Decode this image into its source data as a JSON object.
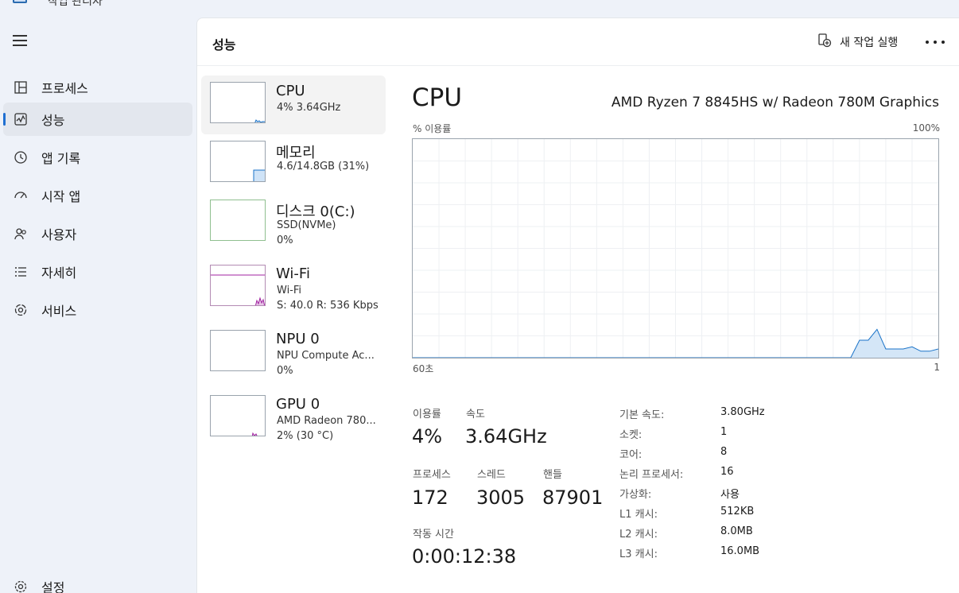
{
  "window": {
    "title": "작업 관리자"
  },
  "sidebar": {
    "items": [
      {
        "label": "프로세스",
        "icon": "processes-icon"
      },
      {
        "label": "성능",
        "icon": "performance-icon",
        "active": true
      },
      {
        "label": "앱 기록",
        "icon": "history-icon"
      },
      {
        "label": "시작 앱",
        "icon": "startup-icon"
      },
      {
        "label": "사용자",
        "icon": "users-icon"
      },
      {
        "label": "자세히",
        "icon": "details-icon"
      },
      {
        "label": "서비스",
        "icon": "services-icon"
      }
    ],
    "settings_label": "설정"
  },
  "header": {
    "title": "성능",
    "run_task_label": "새 작업 실행"
  },
  "devices": [
    {
      "name": "CPU",
      "sub1": "4% 3.64GHz",
      "sub2": "",
      "color": "#1a73c8"
    },
    {
      "name": "메모리",
      "sub1": "4.6/14.8GB (31%)",
      "sub2": "",
      "color": "#1a73c8"
    },
    {
      "name": "디스크 0(C:)",
      "sub1": "SSD(NVMe)",
      "sub2": "0%",
      "color": "#4caf50"
    },
    {
      "name": "Wi-Fi",
      "sub1": "Wi-Fi",
      "sub2": "S: 40.0 R: 536 Kbps",
      "color": "#a020a0"
    },
    {
      "name": "NPU 0",
      "sub1": "NPU Compute Ac...",
      "sub2": "0%",
      "color": "#1a73c8"
    },
    {
      "name": "GPU 0",
      "sub1": "AMD Radeon 780...",
      "sub2": "2% (30 °C)",
      "color": "#a020a0"
    }
  ],
  "detail": {
    "title": "CPU",
    "model": "AMD Ryzen 7 8845HS w/ Radeon 780M Graphics",
    "graph_label_left": "% 이용률",
    "graph_label_right": "100%",
    "graph_bottom_left": "60초",
    "graph_bottom_right": "1",
    "stats": {
      "utilization_label": "이용률",
      "utilization": "4%",
      "speed_label": "속도",
      "speed": "3.64GHz",
      "processes_label": "프로세스",
      "processes": "172",
      "threads_label": "스레드",
      "threads": "3005",
      "handles_label": "핸들",
      "handles": "87901",
      "uptime_label": "작동 시간",
      "uptime": "0:00:12:38"
    },
    "specs": [
      {
        "key": "기본 속도:",
        "value": "3.80GHz"
      },
      {
        "key": "소켓:",
        "value": "1"
      },
      {
        "key": "코어:",
        "value": "8"
      },
      {
        "key": "논리 프로세서:",
        "value": "16"
      },
      {
        "key": "가상화:",
        "value": "사용"
      },
      {
        "key": "L1 캐시:",
        "value": "512KB"
      },
      {
        "key": "L2 캐시:",
        "value": "8.0MB"
      },
      {
        "key": "L3 캐시:",
        "value": "16.0MB"
      }
    ]
  },
  "chart_data": {
    "type": "area",
    "ylim": [
      0,
      100
    ],
    "xlim": [
      60,
      0
    ],
    "series": [
      {
        "values": [
          0,
          0,
          0,
          0,
          0,
          0,
          0,
          0,
          0,
          0,
          0,
          0,
          0,
          0,
          0,
          0,
          0,
          0,
          0,
          0,
          0,
          0,
          0,
          0,
          0,
          0,
          0,
          0,
          0,
          0,
          0,
          0,
          0,
          0,
          0,
          0,
          0,
          0,
          0,
          0,
          0,
          0,
          0,
          0,
          0,
          0,
          0,
          0,
          0,
          0,
          0,
          8,
          8,
          13,
          4,
          4,
          4,
          5,
          3,
          3,
          4
        ]
      }
    ],
    "grid": true,
    "color": "#1a73c8"
  }
}
